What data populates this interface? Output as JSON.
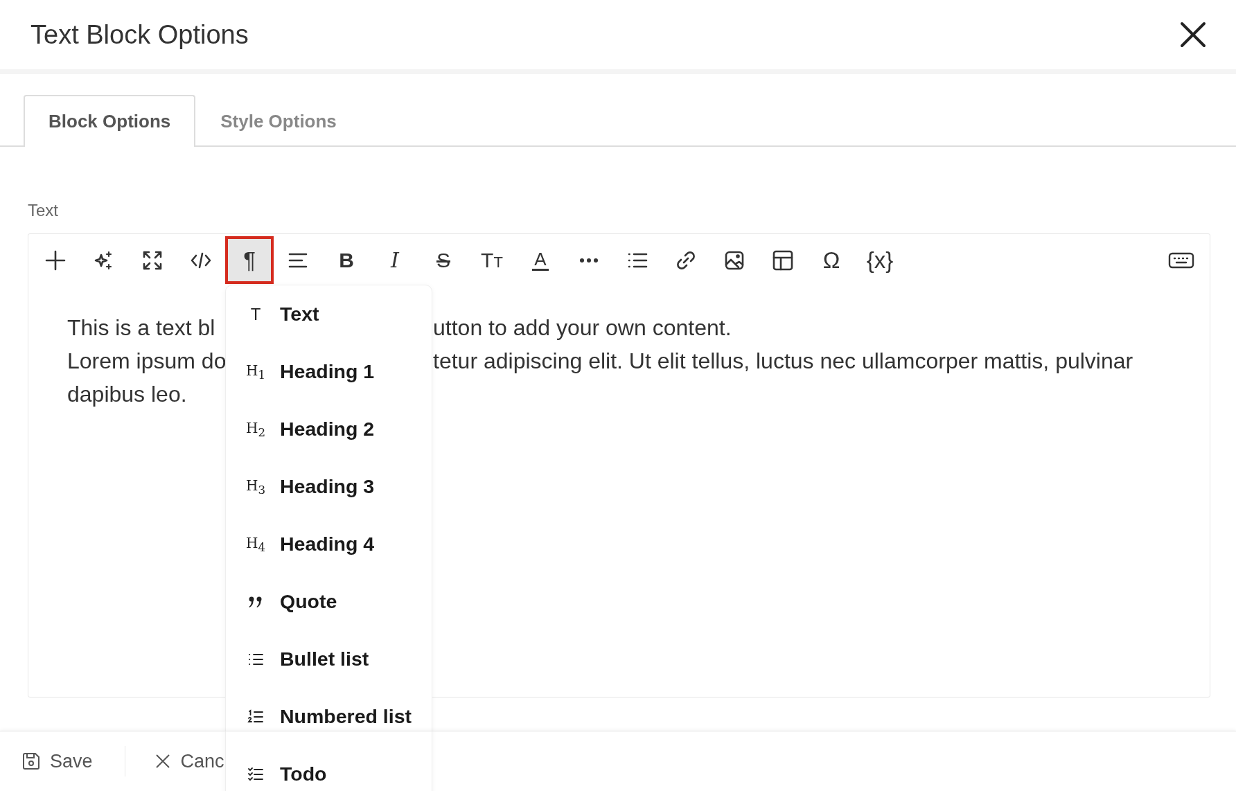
{
  "window": {
    "title": "Text Block Options"
  },
  "tabs": [
    {
      "label": "Block Options",
      "selected": true
    },
    {
      "label": "Style Options",
      "selected": false
    }
  ],
  "field_label": "Text",
  "toolbar": [
    {
      "kind": "plus",
      "selected": false
    },
    {
      "kind": "sparkle",
      "selected": false
    },
    {
      "kind": "expand",
      "selected": false
    },
    {
      "kind": "code",
      "selected": false
    },
    {
      "kind": "glyph",
      "glyph": "¶",
      "selected": true
    },
    {
      "kind": "align",
      "selected": false
    },
    {
      "kind": "bold",
      "glyph": "B",
      "selected": false
    },
    {
      "kind": "italic",
      "glyph": "I",
      "selected": false
    },
    {
      "kind": "strike",
      "glyph": "S",
      "selected": false
    },
    {
      "kind": "size",
      "glyph": "T",
      "glyph_small": "T",
      "selected": false
    },
    {
      "kind": "color",
      "glyph": "A",
      "selected": false
    },
    {
      "kind": "more",
      "selected": false
    },
    {
      "kind": "list",
      "selected": false
    },
    {
      "kind": "link",
      "selected": false
    },
    {
      "kind": "image",
      "selected": false
    },
    {
      "kind": "table",
      "selected": false
    },
    {
      "kind": "glyph",
      "glyph": "Ω",
      "selected": false
    },
    {
      "kind": "glyph",
      "glyph": "{x}",
      "selected": false
    }
  ],
  "body_lines": [
    {
      "left": "This is a text bl",
      "right": "utton to add your own content."
    },
    {
      "left": "Lorem ipsum do",
      "right": "tetur adipiscing elit. Ut elit tellus, luctus nec ullamcorper mattis, pulvinar"
    },
    {
      "left": "dapibus leo."
    }
  ],
  "dropdown": [
    {
      "kind": "text",
      "icon": "T",
      "label": "Text"
    },
    {
      "kind": "heading",
      "icon": "H$_{1}$",
      "label": "Heading 1"
    },
    {
      "kind": "heading",
      "icon": "H$_{2}$",
      "label": "Heading 2"
    },
    {
      "kind": "heading",
      "icon": "H$_{3}$",
      "label": "Heading 3"
    },
    {
      "kind": "heading",
      "icon": "H$_{4}$",
      "label": "Heading 4"
    },
    {
      "kind": "quote",
      "label": "Quote"
    },
    {
      "kind": "bullet",
      "label": "Bullet list"
    },
    {
      "kind": "numbered",
      "label": "Numbered list"
    },
    {
      "kind": "todo",
      "label": "Todo"
    }
  ],
  "footer": {
    "save": "Save",
    "cancel": "Canc"
  }
}
